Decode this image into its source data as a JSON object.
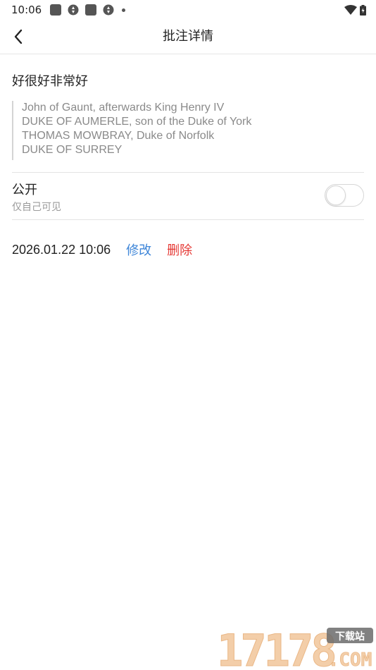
{
  "status_bar": {
    "time": "10:06"
  },
  "nav": {
    "title": "批注详情",
    "back_icon": "chevron-left-icon"
  },
  "annotation": {
    "note": "好很好非常好",
    "quote_lines": [
      "John of Gaunt, afterwards King Henry IV",
      "DUKE OF AUMERLE, son of the Duke of York",
      "THOMAS MOWBRAY, Duke of Norfolk",
      "DUKE OF SURREY"
    ]
  },
  "visibility": {
    "label": "公开",
    "sublabel": "仅自己可见",
    "public_enabled": false
  },
  "meta": {
    "datetime": "2026.01.22 10:06",
    "edit_label": "修改",
    "delete_label": "删除"
  },
  "colors": {
    "edit": "#3d85d8",
    "delete": "#e53935",
    "quote_text": "#8a8a8a"
  },
  "watermark": {
    "number": "17178",
    "tag": "下载站",
    "domain": ".COM"
  }
}
